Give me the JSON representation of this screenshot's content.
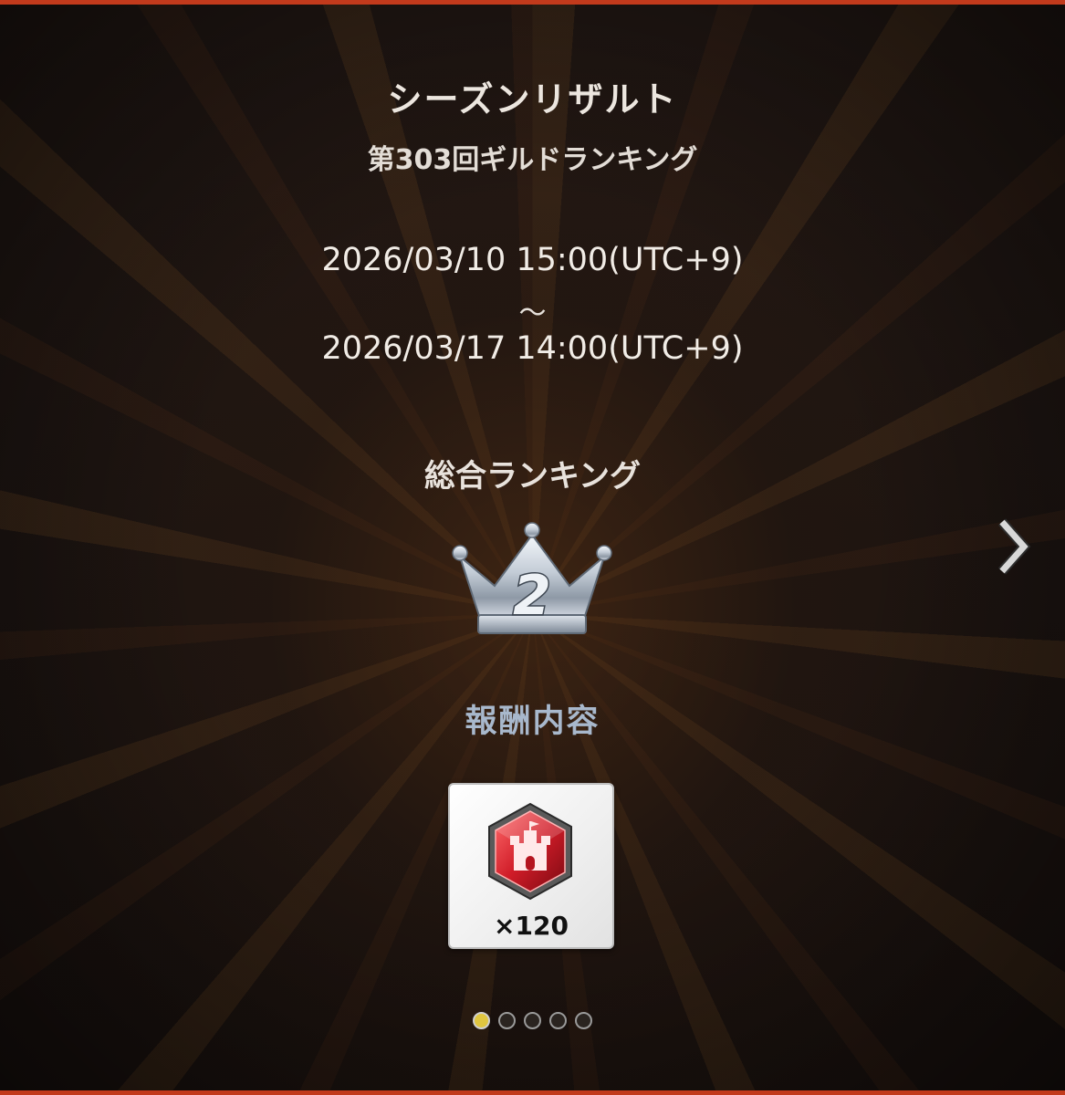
{
  "header": {
    "title": "シーズンリザルト",
    "subtitle": "第303回ギルドランキング"
  },
  "period": {
    "start": "2026/03/10 15:00(UTC+9)",
    "separator": "〜",
    "end": "2026/03/17 14:00(UTC+9)"
  },
  "ranking": {
    "label": "総合ランキング",
    "rank": "2"
  },
  "reward": {
    "label": "報酬内容",
    "count": "×120",
    "icon": "castle-gem-icon"
  },
  "pagination": {
    "total": 5,
    "current": 1
  },
  "colors": {
    "accent_red": "#c23a1c",
    "reward_label": "#a8b8cc",
    "active_dot": "#e0c640"
  }
}
